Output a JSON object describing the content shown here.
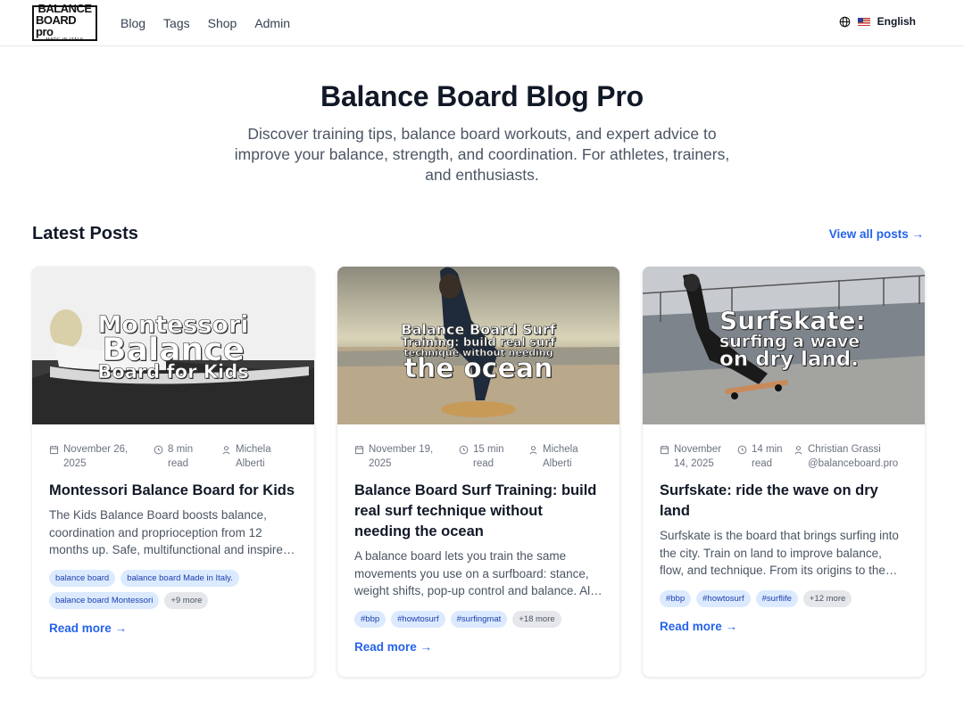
{
  "header": {
    "logo_line1": "BALANCE",
    "logo_line2": "BOARD pro",
    "logo_line3": "MADE IN ITALY",
    "nav": [
      "Blog",
      "Tags",
      "Shop",
      "Admin"
    ],
    "language": "English"
  },
  "hero": {
    "title": "Balance Board Blog Pro",
    "subtitle": "Discover training tips, balance board workouts, and expert advice to improve your balance, strength, and coordination. For athletes, trainers, and enthusiasts."
  },
  "section": {
    "title": "Latest Posts",
    "view_all": "View all posts →"
  },
  "posts": [
    {
      "image_text": [
        "Montessori",
        "Balance",
        "Board for Kids"
      ],
      "date": "November 26, 2025",
      "read_time": "8 min read",
      "author": "Michela Alberti",
      "title": "Montessori Balance Board for Kids",
      "excerpt": "The Kids Balance Board boosts balance, coordination and proprioception from 12 months up. Safe, multifunctional and inspired by Montessori principles.",
      "tags": [
        "balance board",
        "balance board Made in Italy.",
        "balance board Montessori"
      ],
      "more_tags": "+9 more",
      "read_more": "Read more →"
    },
    {
      "image_text": [
        "Balance Board Surf",
        "Training: build real surf",
        "technique without needing",
        "the ocean"
      ],
      "date": "November 19, 2025",
      "read_time": "15 min read",
      "author": "Michela Alberti",
      "title": "Balance Board Surf Training: build real surf technique without needing the ocean",
      "excerpt": "A balance board lets you train the same movements you use on a surfboard: stance, weight shifts, pop-up control and balance. All at home.",
      "tags": [
        "#bbp",
        "#howtosurf",
        "#surfingmat"
      ],
      "more_tags": "+18 more",
      "read_more": "Read more →"
    },
    {
      "image_text": [
        "Surfskate:",
        "surfing a wave",
        "on dry land."
      ],
      "date": "November 14, 2025",
      "read_time": "14 min read",
      "author": "Christian Grassi @balanceboard.pro",
      "title": "Surfskate: ride the wave on dry land",
      "excerpt": "Surfskate is the board that brings surfing into the city. Train on land to improve balance, flow, and technique. From its origins to the trucks, everything you need.",
      "tags": [
        "#bbp",
        "#howtosurf",
        "#surflife"
      ],
      "more_tags": "+12 more",
      "read_more": "Read more →"
    }
  ]
}
